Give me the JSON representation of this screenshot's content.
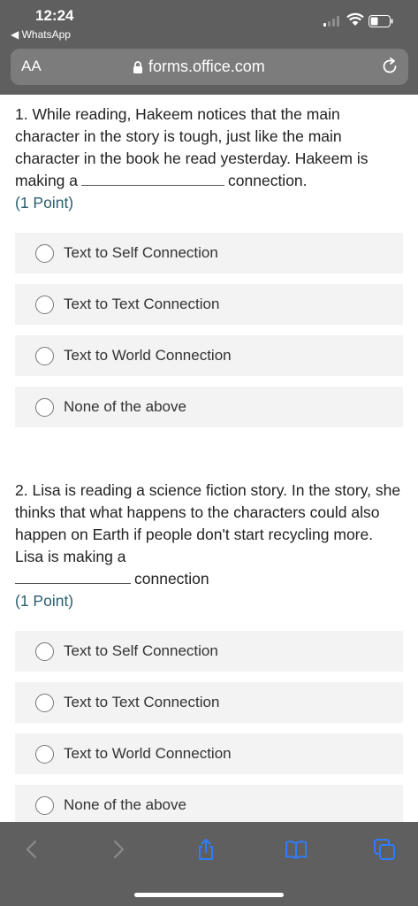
{
  "status_bar": {
    "time": "12:24",
    "back_app": "WhatsApp"
  },
  "browser": {
    "text_size_label": "AA",
    "url": "forms.office.com"
  },
  "questions": [
    {
      "text_before_blank": "1. While reading, Hakeem notices that the main character in the story is tough, just like the main character in the book he read yesterday. Hakeem is making a",
      "text_after_blank": "connection.",
      "points": "(1 Point)",
      "options": [
        "Text to Self Connection",
        "Text to Text Connection",
        "Text to World Connection",
        "None of the above"
      ]
    },
    {
      "text_before_blank": "2. Lisa is reading a science fiction story. In the story, she thinks that what happens to the characters could also happen on Earth if people don't start recycling more. Lisa is making a",
      "text_after_blank": "connection",
      "points": "(1 Point)",
      "options": [
        "Text to Self Connection",
        "Text to Text Connection",
        "Text to World Connection",
        "None of the above"
      ]
    }
  ],
  "toolbar_icons": [
    "back-arrow-icon",
    "forward-arrow-icon",
    "share-icon",
    "bookmarks-icon",
    "tabs-icon"
  ],
  "colors": {
    "chrome": "#5f5f5f",
    "option_bg": "#f3f3f3",
    "points": "#2b5f6e",
    "accent_icon": "#2f7bff"
  }
}
